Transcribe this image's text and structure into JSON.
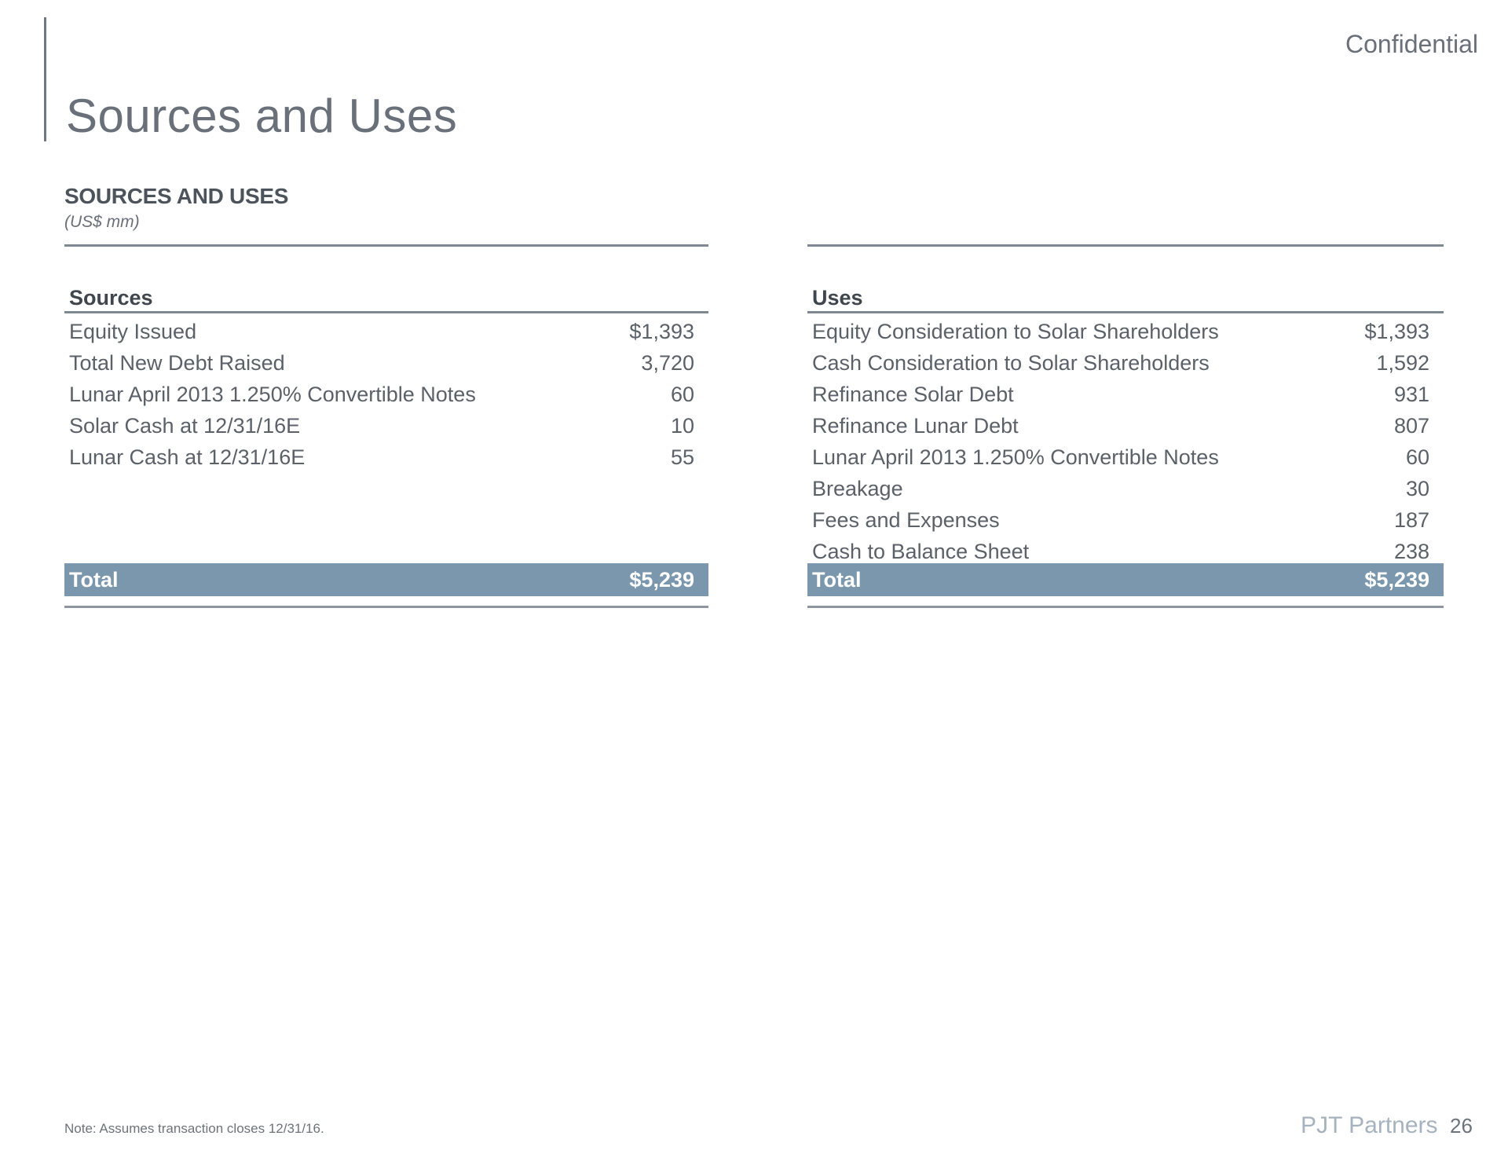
{
  "header": {
    "title": "Sources and Uses",
    "confidential": "Confidential"
  },
  "section": {
    "heading": "SOURCES AND USES",
    "units": "(US$ mm)"
  },
  "sources": {
    "header": "Sources",
    "rows": [
      {
        "label": "Equity Issued",
        "value": "$1,393"
      },
      {
        "label": "Total New Debt Raised",
        "value": "3,720"
      },
      {
        "label": "Lunar April 2013 1.250% Convertible Notes",
        "value": "60"
      },
      {
        "label": "Solar Cash at 12/31/16E",
        "value": "10"
      },
      {
        "label": "Lunar Cash at 12/31/16E",
        "value": "55"
      }
    ],
    "total_label": "Total",
    "total_value": "$5,239"
  },
  "uses": {
    "header": "Uses",
    "rows": [
      {
        "label": "Equity Consideration to Solar Shareholders",
        "value": "$1,393"
      },
      {
        "label": "Cash Consideration to Solar Shareholders",
        "value": "1,592"
      },
      {
        "label": "Refinance Solar Debt",
        "value": "931"
      },
      {
        "label": "Refinance Lunar Debt",
        "value": "807"
      },
      {
        "label": "Lunar April 2013 1.250% Convertible Notes",
        "value": "60"
      },
      {
        "label": "Breakage",
        "value": "30"
      },
      {
        "label": "Fees and Expenses",
        "value": "187"
      },
      {
        "label": "Cash to Balance Sheet",
        "value": "238"
      }
    ],
    "total_label": "Total",
    "total_value": "$5,239"
  },
  "footer": {
    "note": "Note: Assumes transaction closes 12/31/16.",
    "brand": "PJT Partners",
    "page_number": "26"
  },
  "colors": {
    "total_bar": "#7b97ad",
    "rule": "#7d8893",
    "brand": "#a6b3be"
  }
}
